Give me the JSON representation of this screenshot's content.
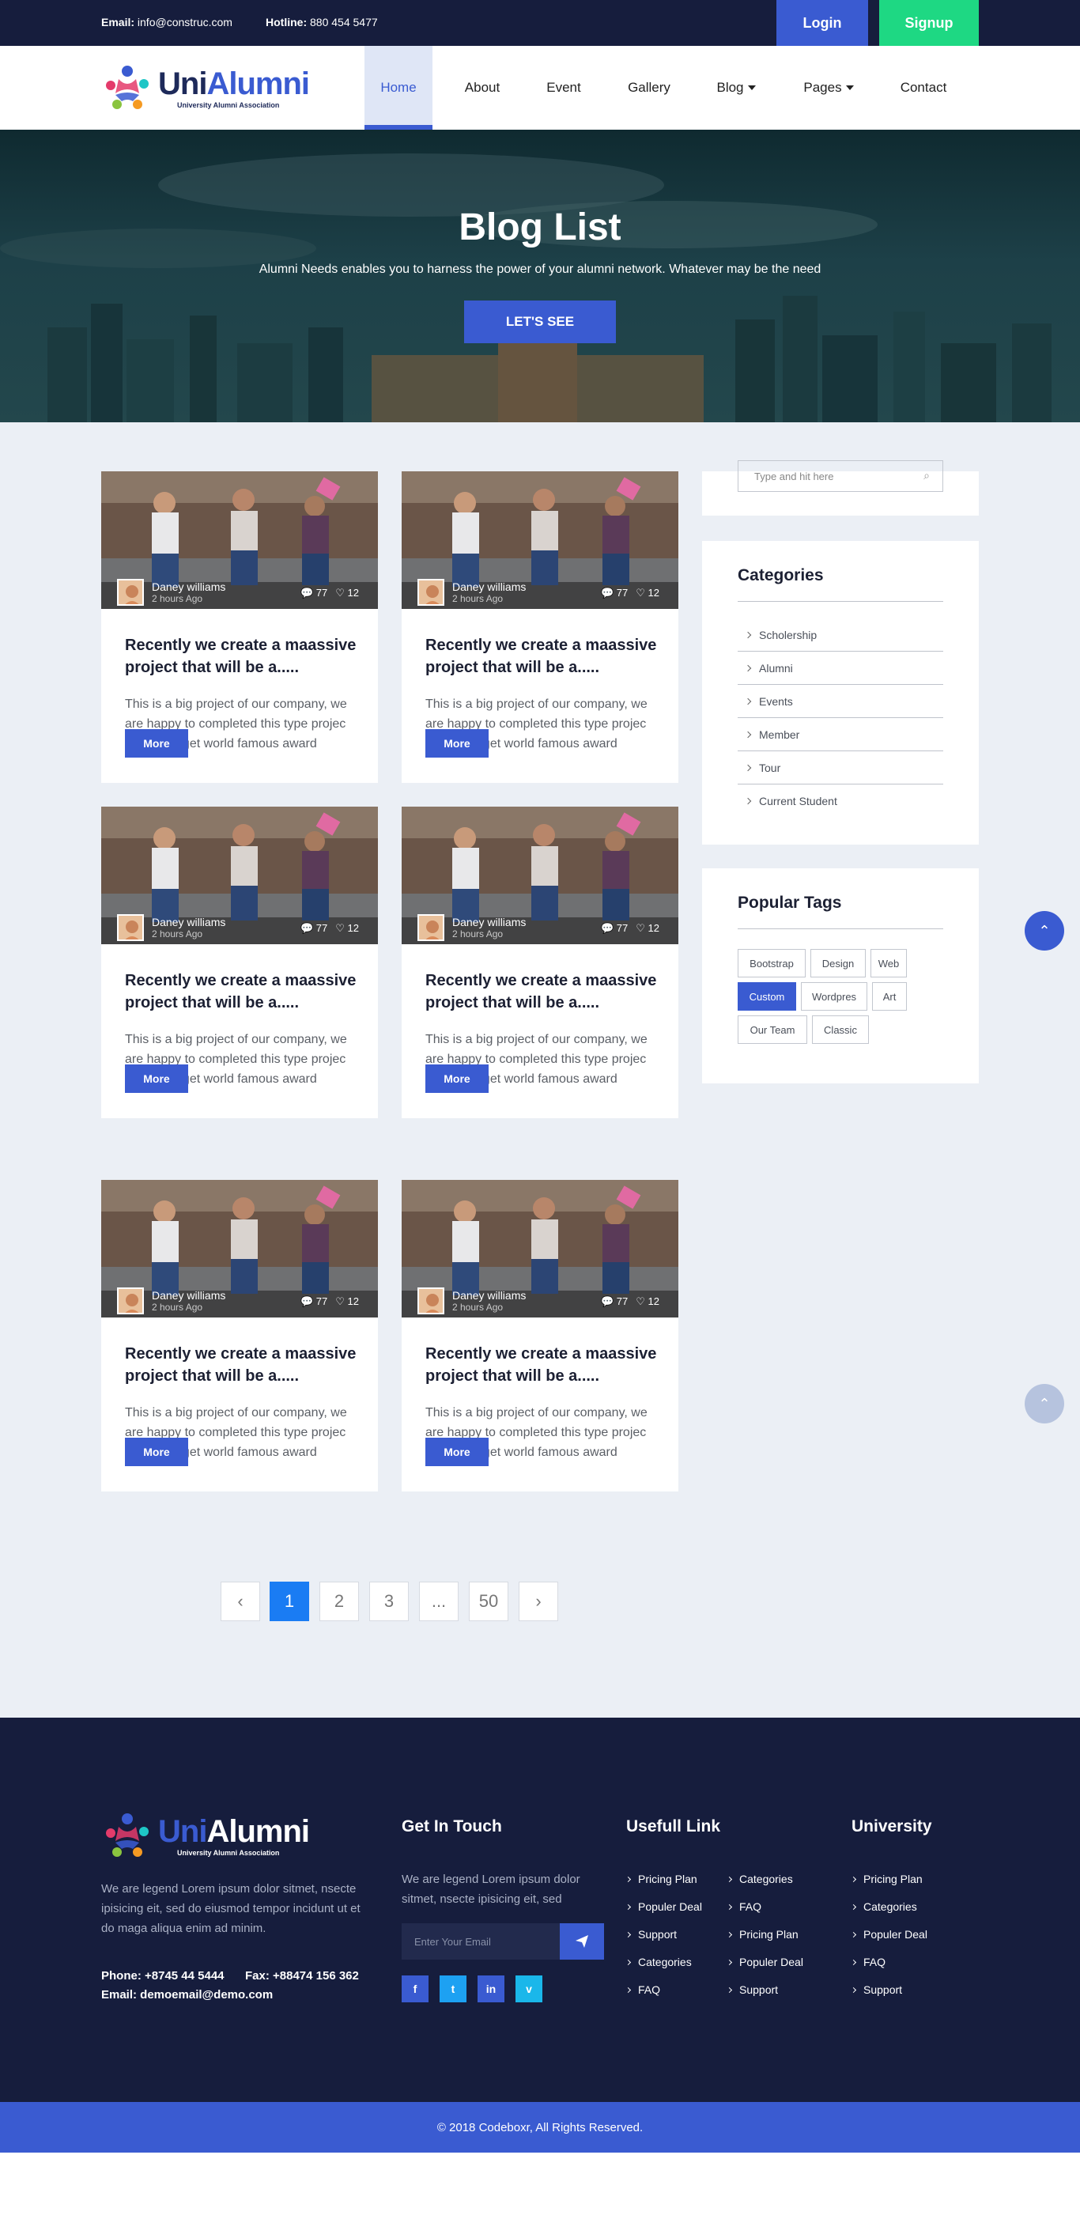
{
  "topbar": {
    "email_label": "Email:",
    "email_value": "info@construc.com",
    "hotline_label": "Hotline:",
    "hotline_value": "880 454 5477",
    "login_label": "Login",
    "signup_label": "Signup"
  },
  "brand": {
    "name_part1": "Uni",
    "name_part2": "Alumni",
    "tagline": "University Alumni Association"
  },
  "nav": {
    "items": [
      {
        "label": "Home",
        "active": true
      },
      {
        "label": "About"
      },
      {
        "label": "Event"
      },
      {
        "label": "Gallery"
      },
      {
        "label": "Blog",
        "dropdown": true
      },
      {
        "label": "Pages",
        "dropdown": true
      },
      {
        "label": "Contact"
      }
    ]
  },
  "hero": {
    "title": "Blog List",
    "subtitle": "Alumni Needs enables you to harness the power of your alumni network. Whatever may be the need",
    "cta_label": "LET'S SEE"
  },
  "posts": [
    {
      "author": "Daney williams",
      "time": "2 hours Ago",
      "comments": "77",
      "likes": "12",
      "title": "Recently we create a maassive project that will be a.....",
      "excerpt": "This is a big project of our company, we are happy to completed this type projec which are get world famous award",
      "more_label": "More"
    },
    {
      "author": "Daney williams",
      "time": "2 hours Ago",
      "comments": "77",
      "likes": "12",
      "title": "Recently we create a maassive project that will be a.....",
      "excerpt": "This is a big project of our company, we are happy to completed this type projec which are get world famous award",
      "more_label": "More"
    },
    {
      "author": "Daney williams",
      "time": "2 hours Ago",
      "comments": "77",
      "likes": "12",
      "title": "Recently we create a maassive project that will be a.....",
      "excerpt": "This is a big project of our company, we are happy to completed this type projec which are get world famous award",
      "more_label": "More"
    },
    {
      "author": "Daney williams",
      "time": "2 hours Ago",
      "comments": "77",
      "likes": "12",
      "title": "Recently we create a maassive project that will be a.....",
      "excerpt": "This is a big project of our company, we are happy to completed this type projec which are get world famous award",
      "more_label": "More"
    },
    {
      "author": "Daney williams",
      "time": "2 hours Ago",
      "comments": "77",
      "likes": "12",
      "title": "Recently we create a maassive project that will be a.....",
      "excerpt": "This is a big project of our company, we are happy to completed this type projec which are get world famous award",
      "more_label": "More"
    },
    {
      "author": "Daney williams",
      "time": "2 hours Ago",
      "comments": "77",
      "likes": "12",
      "title": "Recently we create a maassive project that will be a.....",
      "excerpt": "This is a big project of our company, we are happy to completed this type projec which are get world famous award",
      "more_label": "More"
    }
  ],
  "sidebar": {
    "search_placeholder": "Type and hit here",
    "categories_title": "Categories",
    "categories": [
      "Scholership",
      "Alumni",
      "Events",
      "Member",
      "Tour",
      "Current Student"
    ],
    "tags_title": "Popular Tags",
    "tags": [
      {
        "label": "Bootstrap"
      },
      {
        "label": "Design"
      },
      {
        "label": "Web"
      },
      {
        "label": "Custom",
        "active": true
      },
      {
        "label": "Wordpres"
      },
      {
        "label": "Art"
      },
      {
        "label": "Our Team"
      },
      {
        "label": "Classic"
      }
    ]
  },
  "pagination": {
    "prev": "‹",
    "pages": [
      "1",
      "2",
      "3",
      "...",
      "50"
    ],
    "current": "1",
    "next": "›"
  },
  "footer": {
    "about_text": "We are legend Lorem ipsum dolor sitmet, nsecte ipisicing eit, sed do eiusmod tempor incidunt ut et do maga aliqua enim ad minim.",
    "phone": "Phone: +8745 44 5444",
    "fax": "Fax: +88474 156 362",
    "email": "Email: demoemail@demo.com",
    "touch_title": "Get In Touch",
    "touch_text": "We are legend Lorem ipsum dolor sitmet, nsecte ipisicing eit, sed",
    "email_placeholder": "Enter Your Email",
    "social": [
      "f",
      "t",
      "in",
      "v"
    ],
    "useful_title": "Usefull Link",
    "useful_col1": [
      "Pricing Plan",
      "Populer Deal",
      "Support",
      "Categories",
      "FAQ"
    ],
    "useful_col2": [
      "Categories",
      "FAQ",
      "Pricing Plan",
      "Populer Deal",
      "Support"
    ],
    "university_title": "University",
    "university_links": [
      "Pricing Plan",
      "Categories",
      "Populer Deal",
      "FAQ",
      "Support"
    ],
    "copyright": "© 2018 Codeboxr, All Rights Reserved."
  },
  "colors": {
    "navy": "#161d3d",
    "accent": "#3a5bd1",
    "signup_green": "#1ed883",
    "page_bg": "#ebeff5",
    "pagination_active": "#1a7cf3"
  }
}
